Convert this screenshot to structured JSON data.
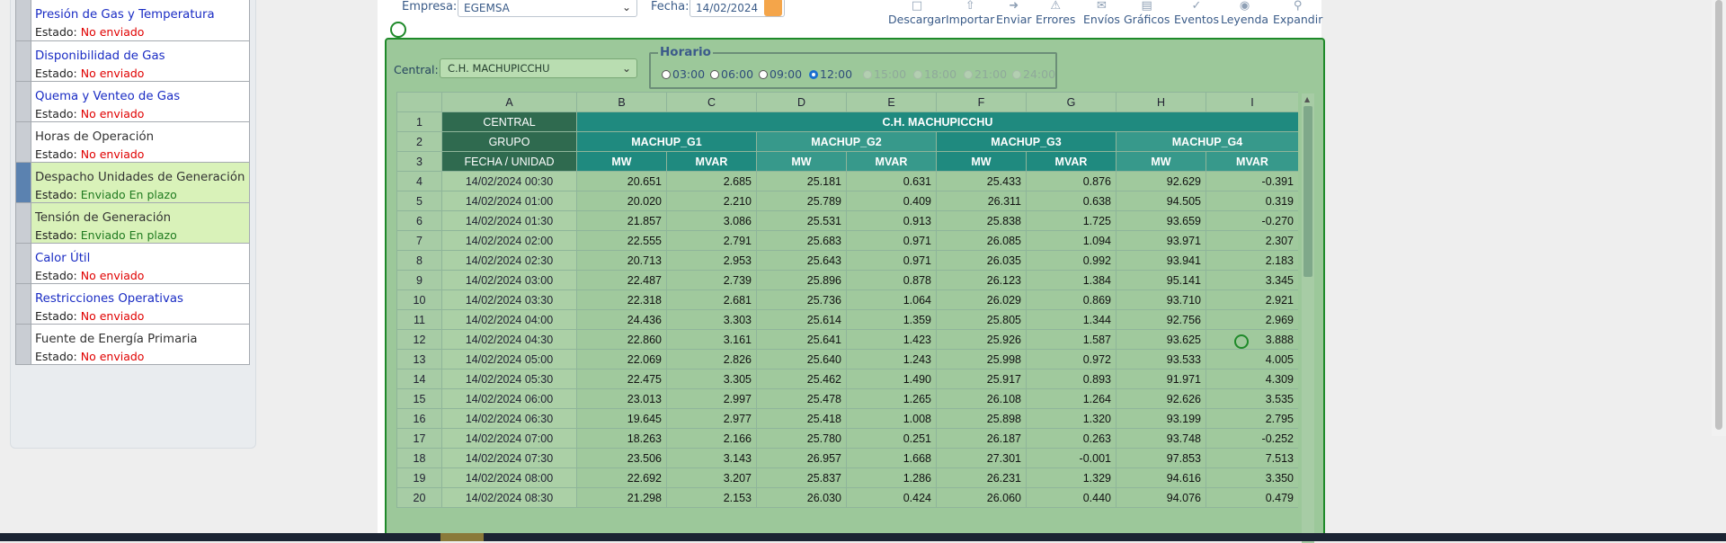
{
  "sidebar": {
    "items": [
      {
        "title": "Presión de Gas y Temperatura",
        "label": "Estado:",
        "status": "No enviado",
        "title_color": "blue",
        "active": false,
        "ok": false
      },
      {
        "title": "Disponibilidad de Gas",
        "label": "Estado:",
        "status": "No enviado",
        "title_color": "blue",
        "active": false,
        "ok": false
      },
      {
        "title": "Quema y Venteo de Gas",
        "label": "Estado:",
        "status": "No enviado",
        "title_color": "blue",
        "active": false,
        "ok": false
      },
      {
        "title": "Horas de Operación",
        "label": "Estado:",
        "status": "No enviado",
        "title_color": "dark",
        "active": false,
        "ok": false
      },
      {
        "title": "Despacho Unidades de Generación",
        "label": "Estado:",
        "status": "Enviado En plazo",
        "title_color": "dark",
        "active": true,
        "ok": true
      },
      {
        "title": "Tensión de Generación",
        "label": "Estado:",
        "status": "Enviado En plazo",
        "title_color": "dark",
        "active": false,
        "ok": true
      },
      {
        "title": "Calor Útil",
        "label": "Estado:",
        "status": "No enviado",
        "title_color": "blue",
        "active": false,
        "ok": false
      },
      {
        "title": "Restricciones Operativas",
        "label": "Estado:",
        "status": "No enviado",
        "title_color": "blue",
        "active": false,
        "ok": false
      },
      {
        "title": "Fuente de Energía Primaria",
        "label": "Estado:",
        "status": "No enviado",
        "title_color": "dark",
        "active": false,
        "ok": false
      }
    ]
  },
  "topbar": {
    "empresa_label": "Empresa:",
    "empresa_value": "EGEMSA",
    "fecha_label": "Fecha:",
    "fecha_value": "14/02/2024",
    "tools": [
      "Descargar",
      "Importar",
      "Enviar",
      "Errores",
      "Envíos",
      "Gráficos",
      "Eventos",
      "Leyenda",
      "Expandir"
    ]
  },
  "panel": {
    "central_label": "Central:",
    "central_value": "C.H. MACHUPICCHU",
    "horario_title": "Horario",
    "horario_options": [
      {
        "label": "03:00",
        "checked": false,
        "disabled": false
      },
      {
        "label": "06:00",
        "checked": false,
        "disabled": false
      },
      {
        "label": "09:00",
        "checked": false,
        "disabled": false
      },
      {
        "label": "12:00",
        "checked": true,
        "disabled": false
      },
      {
        "label": "15:00",
        "checked": false,
        "disabled": true
      },
      {
        "label": "18:00",
        "checked": false,
        "disabled": true
      },
      {
        "label": "21:00",
        "checked": false,
        "disabled": true
      },
      {
        "label": "24:00",
        "checked": false,
        "disabled": true
      }
    ]
  },
  "grid": {
    "col_letters": [
      "A",
      "B",
      "C",
      "D",
      "E",
      "F",
      "G",
      "H",
      "I"
    ],
    "central_label": "CENTRAL",
    "central_value": "C.H. MACHUPICCHU",
    "grupo_label": "GRUPO",
    "grupos": [
      "MACHUP_G1",
      "MACHUP_G2",
      "MACHUP_G3",
      "MACHUP_G4"
    ],
    "unidad_label": "FECHA / UNIDAD",
    "units": [
      "MW",
      "MVAR",
      "MW",
      "MVAR",
      "MW",
      "MVAR",
      "MW",
      "MVAR"
    ],
    "rows": [
      {
        "n": "4",
        "date": "14/02/2024 00:30",
        "vals": [
          "20.651",
          "2.685",
          "25.181",
          "0.631",
          "25.433",
          "0.876",
          "92.629",
          "-0.391"
        ]
      },
      {
        "n": "5",
        "date": "14/02/2024 01:00",
        "vals": [
          "20.020",
          "2.210",
          "25.789",
          "0.409",
          "26.311",
          "0.638",
          "94.505",
          "0.319"
        ]
      },
      {
        "n": "6",
        "date": "14/02/2024 01:30",
        "vals": [
          "21.857",
          "3.086",
          "25.531",
          "0.913",
          "25.838",
          "1.725",
          "93.659",
          "-0.270"
        ]
      },
      {
        "n": "7",
        "date": "14/02/2024 02:00",
        "vals": [
          "22.555",
          "2.791",
          "25.683",
          "0.971",
          "26.085",
          "1.094",
          "93.971",
          "2.307"
        ]
      },
      {
        "n": "8",
        "date": "14/02/2024 02:30",
        "vals": [
          "20.713",
          "2.953",
          "25.643",
          "0.971",
          "26.035",
          "0.992",
          "93.941",
          "2.183"
        ]
      },
      {
        "n": "9",
        "date": "14/02/2024 03:00",
        "vals": [
          "22.487",
          "2.739",
          "25.896",
          "0.878",
          "26.123",
          "1.384",
          "95.141",
          "3.345"
        ]
      },
      {
        "n": "10",
        "date": "14/02/2024 03:30",
        "vals": [
          "22.318",
          "2.681",
          "25.736",
          "1.064",
          "26.029",
          "0.869",
          "93.710",
          "2.921"
        ]
      },
      {
        "n": "11",
        "date": "14/02/2024 04:00",
        "vals": [
          "24.436",
          "3.303",
          "25.614",
          "1.359",
          "25.805",
          "1.344",
          "92.756",
          "2.969"
        ]
      },
      {
        "n": "12",
        "date": "14/02/2024 04:30",
        "vals": [
          "22.860",
          "3.161",
          "25.641",
          "1.423",
          "25.926",
          "1.587",
          "93.625",
          "3.888"
        ]
      },
      {
        "n": "13",
        "date": "14/02/2024 05:00",
        "vals": [
          "22.069",
          "2.826",
          "25.640",
          "1.243",
          "25.998",
          "0.972",
          "93.533",
          "4.005"
        ]
      },
      {
        "n": "14",
        "date": "14/02/2024 05:30",
        "vals": [
          "22.475",
          "3.305",
          "25.462",
          "1.490",
          "25.917",
          "0.893",
          "91.971",
          "4.309"
        ]
      },
      {
        "n": "15",
        "date": "14/02/2024 06:00",
        "vals": [
          "23.013",
          "2.997",
          "25.478",
          "1.265",
          "26.108",
          "1.264",
          "92.626",
          "3.535"
        ]
      },
      {
        "n": "16",
        "date": "14/02/2024 06:30",
        "vals": [
          "19.645",
          "2.977",
          "25.418",
          "1.008",
          "25.898",
          "1.320",
          "93.199",
          "2.795"
        ]
      },
      {
        "n": "17",
        "date": "14/02/2024 07:00",
        "vals": [
          "18.263",
          "2.166",
          "25.780",
          "0.251",
          "26.187",
          "0.263",
          "93.748",
          "-0.252"
        ]
      },
      {
        "n": "18",
        "date": "14/02/2024 07:30",
        "vals": [
          "23.506",
          "3.143",
          "26.957",
          "1.668",
          "27.301",
          "-0.001",
          "97.853",
          "7.513"
        ]
      },
      {
        "n": "19",
        "date": "14/02/2024 08:00",
        "vals": [
          "22.692",
          "3.207",
          "25.837",
          "1.286",
          "26.231",
          "1.329",
          "94.616",
          "3.350"
        ]
      },
      {
        "n": "20",
        "date": "14/02/2024 08:30",
        "vals": [
          "21.298",
          "2.153",
          "26.030",
          "0.424",
          "26.060",
          "0.440",
          "94.076",
          "0.479"
        ]
      }
    ]
  }
}
